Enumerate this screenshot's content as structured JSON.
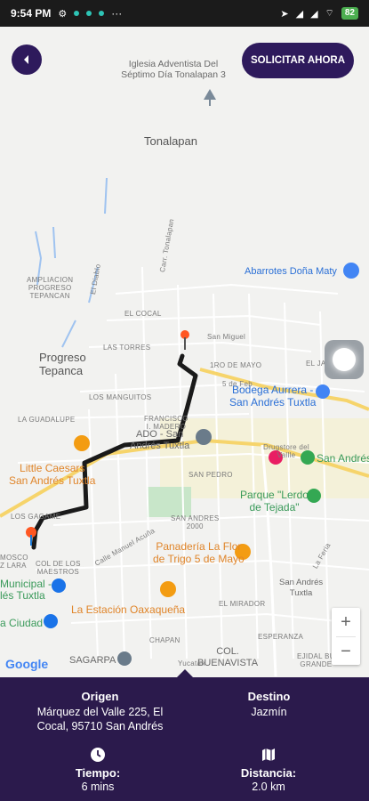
{
  "status_bar": {
    "time": "9:54 PM",
    "battery": "82",
    "more": "···"
  },
  "header": {
    "back_icon": "chevron-left-icon",
    "solicitar_label": "SOLICITAR AHORA"
  },
  "map": {
    "labels": {
      "iglesia": "Iglesia Adventista Del\nSéptimo Día Tonalapan 3",
      "tonalapan": "Tonalapan",
      "abarrotes": "Abarrotes Doña Maty",
      "ampliacion": "AMPLIACION\nPROGRESO\nTEPANCAN",
      "el_diablo": "El Diablo",
      "el_cocal": "EL COCAL",
      "carr_tonalapan": "Carr. Tonalapan",
      "las_torres": "LAS TORRES",
      "san_miguel": "San Miguel",
      "progreso": "Progreso\nTepanca",
      "tro_de_mayo": "1RO DE MAYO",
      "el_jardin": "EL JARDIN",
      "cinco_feb": "5 de Feb",
      "bodega": "Bodega Aurrera -\nSan Andrés Tuxtla",
      "los_mangos": "LOS MANGUITOS",
      "la_guadalupe": "LA GUADALUPE",
      "francisco": "FRANCISCO\nI. MADERO",
      "ado": "ADO - San\nAndrés Tuxtla",
      "little_caesars": "Little Caesars\nSan Andrés Tuxtla",
      "drugstore": "Drugstore del\nVallle",
      "san_andres_right": "San Andrés",
      "san_pedro": "SAN PEDRO",
      "parque": "Parque \"Lerdo\nde Tejada\"",
      "los_gagamies": "LOS GAGAME",
      "san_andres_2000": "SAN ANDRES\n2000",
      "panaderia": "Panadería La Flor\nde Trigo 5 de Mayo",
      "mosco": "MOSCO\nZ LARA",
      "col_maestros": "COL DE LOS\nMAESTROS",
      "municipal": "Municipal -\nlés Tuxtla",
      "san_andres_tuxtla": "San Andrés\nTuxtla",
      "la_estacion": "La Estación Oaxaqueña",
      "ciudad": "a Ciudad",
      "el_mirador": "EL MIRADOR",
      "esperanza": "ESPERANZA",
      "chapan": "CHAPAN",
      "sagarpa": "SAGARPA",
      "col_buenavista": "COL.\nBUENAVISTA",
      "ejidal": "EJIDAL BU\nGRANDE",
      "yucatan": "Yucatán",
      "calle_manuel": "Calle Manuel Acuña",
      "la_feria": "La Feria"
    },
    "google": "Google",
    "zoom_in": "+",
    "zoom_out": "−",
    "colors": {
      "route": "#1a1a1a",
      "pin": "#ea4335",
      "accent": "#2e1a5c"
    }
  },
  "info": {
    "origen_title": "Origen",
    "origen_value": "Márquez del Valle 225, El\nCocal, 95710 San Andrés",
    "destino_title": "Destino",
    "destino_value": "Jazmín",
    "tiempo_title": "Tiempo:",
    "tiempo_value": "6 mins",
    "tiempo_icon": "clock-icon",
    "distancia_title": "Distancia:",
    "distancia_value": "2.0 km",
    "distancia_icon": "map-icon",
    "panel_color": "#2b1a4c"
  }
}
